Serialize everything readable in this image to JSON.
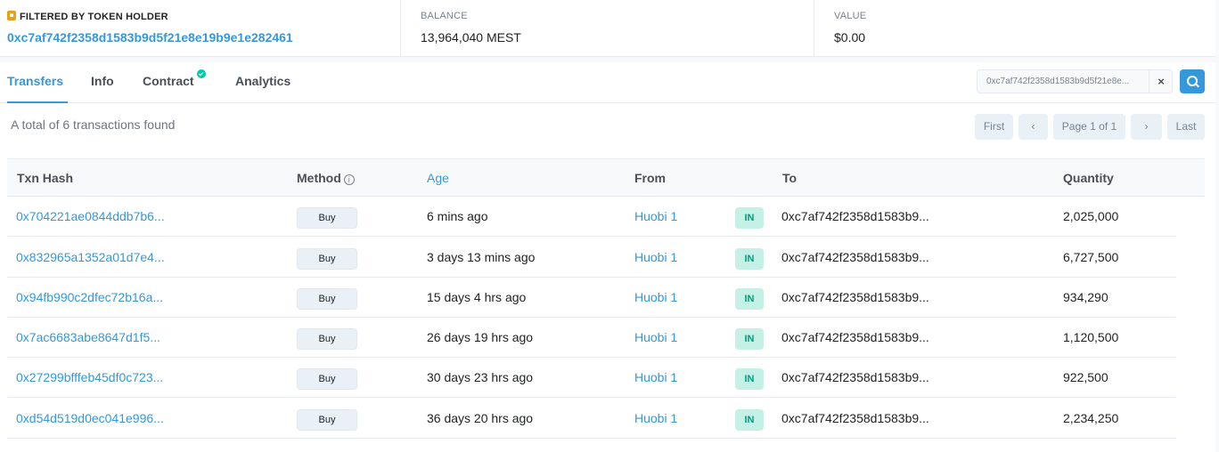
{
  "header": {
    "filtered_label": "FILTERED BY TOKEN HOLDER",
    "holder_address": "0xc7af742f2358d1583b9d5f21e8e19b9e1e282461",
    "balance_label": "BALANCE",
    "balance_value": "13,964,040 MEST",
    "value_label": "VALUE",
    "value_value": "$0.00"
  },
  "tabs": [
    {
      "label": "Transfers",
      "active": true
    },
    {
      "label": "Info"
    },
    {
      "label": "Contract",
      "verified": true
    },
    {
      "label": "Analytics"
    }
  ],
  "search": {
    "value": "0xc7af742f2358d1583b9d5f21e8e...",
    "clear": "×"
  },
  "summary": "A total of 6 transactions found",
  "pager": {
    "first": "First",
    "prev": "‹",
    "info": "Page 1 of 1",
    "next": "›",
    "last": "Last"
  },
  "table": {
    "headers": {
      "txn_hash": "Txn Hash",
      "method": "Method",
      "age": "Age",
      "from": "From",
      "to": "To",
      "quantity": "Quantity"
    },
    "rows": [
      {
        "hash": "0x704221ae0844ddb7b6...",
        "method": "Buy",
        "age": "6 mins ago",
        "from": "Huobi 1",
        "dir": "IN",
        "to": "0xc7af742f2358d1583b9...",
        "qty": "2,025,000"
      },
      {
        "hash": "0x832965a1352a01d7e4...",
        "method": "Buy",
        "age": "3 days 13 mins ago",
        "from": "Huobi 1",
        "dir": "IN",
        "to": "0xc7af742f2358d1583b9...",
        "qty": "6,727,500"
      },
      {
        "hash": "0x94fb990c2dfec72b16a...",
        "method": "Buy",
        "age": "15 days 4 hrs ago",
        "from": "Huobi 1",
        "dir": "IN",
        "to": "0xc7af742f2358d1583b9...",
        "qty": "934,290"
      },
      {
        "hash": "0x7ac6683abe8647d1f5...",
        "method": "Buy",
        "age": "26 days 19 hrs ago",
        "from": "Huobi 1",
        "dir": "IN",
        "to": "0xc7af742f2358d1583b9...",
        "qty": "1,120,500"
      },
      {
        "hash": "0x27299bfffeb45df0c723...",
        "method": "Buy",
        "age": "30 days 23 hrs ago",
        "from": "Huobi 1",
        "dir": "IN",
        "to": "0xc7af742f2358d1583b9...",
        "qty": "922,500"
      },
      {
        "hash": "0xd54d519d0ec041e996...",
        "method": "Buy",
        "age": "36 days 20 hrs ago",
        "from": "Huobi 1",
        "dir": "IN",
        "to": "0xc7af742f2358d1583b9...",
        "qty": "2,234,250"
      }
    ]
  },
  "colors": {
    "accent": "#3498db",
    "in_badge_bg": "#c5f0e5",
    "in_badge_text": "#009e7f",
    "verified": "#00c9a7"
  }
}
